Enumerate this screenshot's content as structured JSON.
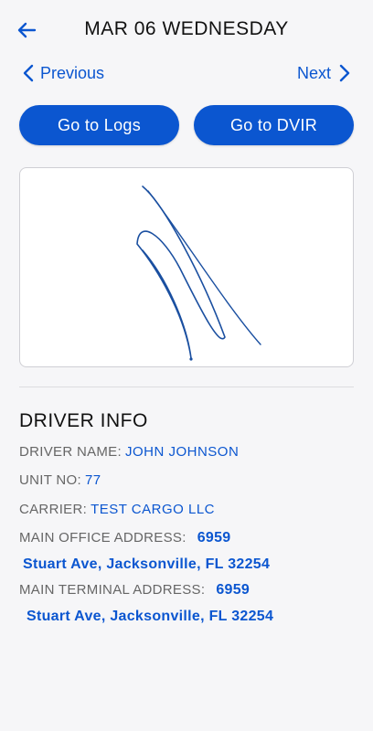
{
  "header": {
    "title": "MAR 06 WEDNESDAY"
  },
  "nav": {
    "previous_label": "Previous",
    "next_label": "Next"
  },
  "actions": {
    "logs_label": "Go to Logs",
    "dvir_label": "Go to DVIR"
  },
  "driver_info": {
    "section_title": "DRIVER INFO",
    "driver_name_label": "DRIVER NAME:",
    "driver_name_value": "JOHN JOHNSON",
    "unit_no_label": "UNIT NO:",
    "unit_no_value": "77",
    "carrier_label": "CARRIER:",
    "carrier_value": "TEST CARGO LLC",
    "main_office_label": "MAIN OFFICE ADDRESS:",
    "main_office_line1": "6959",
    "main_office_line2": "Stuart Ave, Jacksonville, FL 32254",
    "main_terminal_label": "MAIN TERMINAL ADDRESS:",
    "main_terminal_line1": "6959",
    "main_terminal_line2": "Stuart Ave, Jacksonville, FL 32254"
  },
  "colors": {
    "accent": "#0b56d0",
    "background": "#f6f6f8",
    "signature_stroke": "#1a4fa0"
  },
  "icons": {
    "back": "arrow-left-icon",
    "previous": "chevron-left-icon",
    "next": "chevron-right-icon"
  }
}
